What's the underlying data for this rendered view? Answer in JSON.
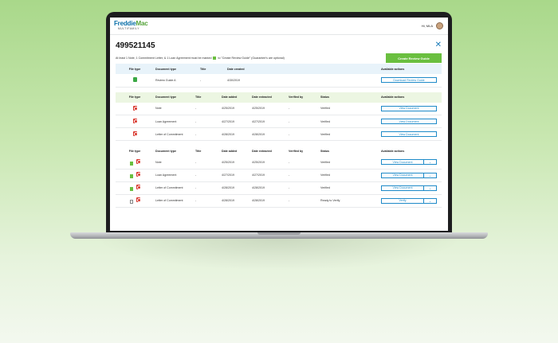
{
  "header": {
    "logo_main_a": "Freddie",
    "logo_main_b": "Mac",
    "logo_sub": "MULTIFAMILY",
    "greeting": "Hi, MLA"
  },
  "page": {
    "title": "499521145",
    "close_icon": "✕",
    "notice_before": "At least 1 Note, 1 Commitment Letter, & 1 Loan Agreement must be marked",
    "notice_after": "to \"Create Review Guide\" (Guarantee's are optional)",
    "create_button": "Create Review Guide"
  },
  "review_guide_table": {
    "headers": [
      "File type",
      "Document type",
      "Title",
      "Date created",
      "Available actions"
    ],
    "rows": [
      {
        "doc_type": "Review Guide A",
        "title": "-",
        "date_created": "4/30/2019",
        "action": "Download Review Guide"
      }
    ]
  },
  "verified_table": {
    "headers": [
      "File type",
      "Document type",
      "Title",
      "Date added",
      "Date extracted",
      "Verified by",
      "Status",
      "Available actions"
    ],
    "rows": [
      {
        "doc_type": "Note",
        "title": "-",
        "date_added": "4/25/2019",
        "date_extracted": "4/25/2019",
        "verified_by": "-",
        "status": "Verified",
        "action": "View Document"
      },
      {
        "doc_type": "Loan Agreement",
        "title": "-",
        "date_added": "4/27/2019",
        "date_extracted": "4/27/2019",
        "verified_by": "-",
        "status": "Verified",
        "action": "View Document"
      },
      {
        "doc_type": "Letter of Commitment",
        "title": "-",
        "date_added": "4/28/2019",
        "date_extracted": "4/28/2019",
        "verified_by": "-",
        "status": "Verified",
        "action": "View Document"
      }
    ]
  },
  "documents_table": {
    "headers": [
      "File type",
      "Document type",
      "Title",
      "Date added",
      "Date extracted",
      "Verified by",
      "Status",
      "Available actions"
    ],
    "rows": [
      {
        "checked": true,
        "doc_type": "Note",
        "title": "-",
        "date_added": "4/25/2019",
        "date_extracted": "4/25/2019",
        "verified_by": "-",
        "status": "Verified",
        "action": "View Document"
      },
      {
        "checked": true,
        "doc_type": "Loan Agreement",
        "title": "-",
        "date_added": "4/27/2019",
        "date_extracted": "4/27/2019",
        "verified_by": "-",
        "status": "Verified",
        "action": "View Document"
      },
      {
        "checked": true,
        "doc_type": "Letter of Commitment",
        "title": "-",
        "date_added": "4/28/2019",
        "date_extracted": "4/28/2019",
        "verified_by": "-",
        "status": "Verified",
        "action": "View Document"
      },
      {
        "checked": false,
        "doc_type": "Letter of Commitment",
        "title": "-",
        "date_added": "4/28/2019",
        "date_extracted": "4/28/2019",
        "verified_by": "-",
        "status": "Ready to Verify",
        "action": "Verify"
      }
    ]
  },
  "colors": {
    "brand_blue": "#0a6fa8",
    "brand_green": "#55a33a",
    "action_green": "#6abf3f",
    "link_blue": "#1e8ac8"
  },
  "icons": {
    "file_xls": "spreadsheet-file-icon",
    "file_pdf": "pdf-file-icon",
    "caret": "chevron-down-icon",
    "checkbox": "checkbox-icon"
  }
}
